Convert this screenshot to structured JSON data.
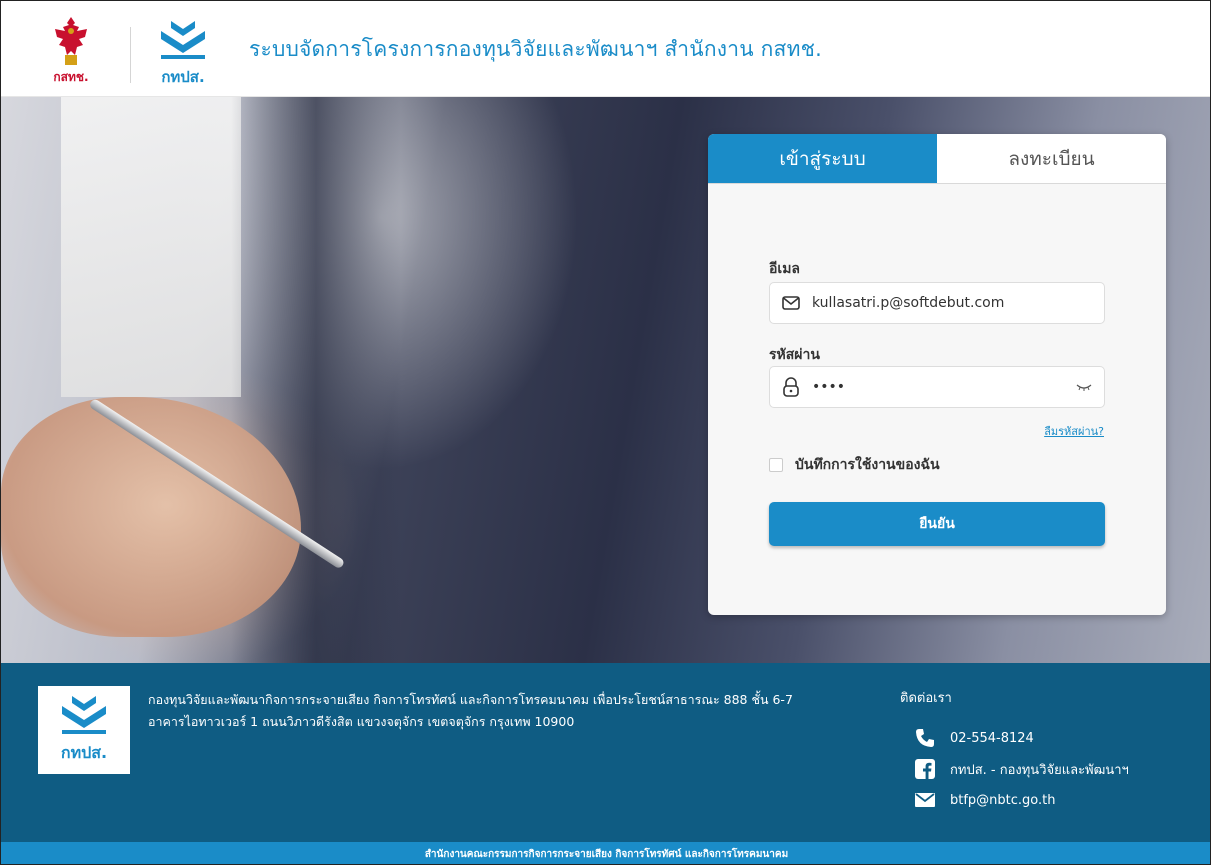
{
  "header": {
    "nbtc_logo_label": "กสทช.",
    "btfp_logo_label": "กทปส.",
    "title": "ระบบจัดการโครงการกองทุนวิจัยและพัฒนาฯ สำนักงาน กสทช."
  },
  "login": {
    "tabs": [
      {
        "label": "เข้าสู่ระบบ",
        "active": true
      },
      {
        "label": "ลงทะเบียน",
        "active": false
      }
    ],
    "email_label": "อีเมล",
    "email_value": "kullasatri.p@softdebut.com",
    "password_label": "รหัสผ่าน",
    "password_value": "••••",
    "forgot_label": "ลืมรหัสผ่าน?",
    "remember_label": "บันทึกการใช้งานของฉัน",
    "submit_label": "ยืนยัน"
  },
  "footer": {
    "logo_label": "กทปส.",
    "address": "กองทุนวิจัยและพัฒนากิจการกระจายเสียง กิจการโทรทัศน์ และกิจการโทรคมนาคม เพื่อประโยชน์สาธารณะ 888 ชั้น 6-7 อาคารไอทาวเวอร์ 1 ถนนวิภาวดีรังสิต แขวงจตุจักร เขตจตุจักร กรุงเทพ 10900",
    "contact_title": "ติดต่อเรา",
    "phone": "02-554-8124",
    "facebook": "กทปส. - กองทุนวิจัยและพัฒนาฯ",
    "email": "btfp@nbtc.go.th",
    "bottom_bar": "สำนักงานคณะกรรมการกิจการกระจายเสียง กิจการโทรทัศน์ และกิจการโทรคมนาคม"
  },
  "colors": {
    "brand_blue": "#1a8cc8",
    "footer_blue": "#0f5c83",
    "nbtc_red": "#c8102e"
  },
  "icons": {
    "email_field": "envelope-icon",
    "password_field": "lock-icon",
    "toggle_password": "eye-closed-icon",
    "phone": "phone-icon",
    "facebook": "facebook-icon",
    "mail": "mail-icon"
  }
}
